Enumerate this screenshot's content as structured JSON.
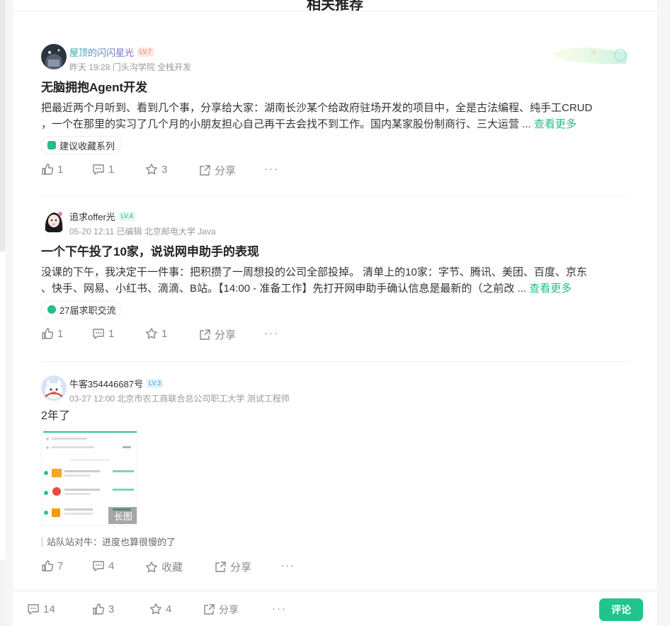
{
  "section_title": "相关推荐",
  "posts": [
    {
      "author": "屋顶的闪闪星光",
      "level": "LV.7",
      "meta": "昨天 19:28  门头沟学院 全栈开发",
      "title": "无脑拥抱Agent开发",
      "body_line1": "把最近两个月听到、看到几个事，分享给大家：湖南长沙某个给政府驻场开发的项目中，全是古法编程、纯手工CRUD",
      "body_line2": "，一个在那里的实习了几个月的小朋友担心自己再干去会找不到工作。国内某家股份制商行、三大运营 ...",
      "more": "查看更多",
      "tag": "建议收藏系列",
      "likes": "1",
      "comments": "1",
      "stars": "3",
      "share": "分享",
      "dots": "···"
    },
    {
      "author": "追求offer光",
      "level": "LV.4",
      "meta": "05-20 12:11  已编辑  北京邮电大学 Java",
      "title": "一个下午投了10家，说说网申助手的表现",
      "body_line1": "没课的下午，我决定干一件事：把积攒了一周想投的公司全部投掉。 清单上的10家：字节、腾讯、美团、百度、京东",
      "body_line2": "、快手、网易、小红书、滴滴、B站。【14:00 - 准备工作】先打开网申助手确认信息是最新的（之前改 ...",
      "more": "查看更多",
      "tag": "27届求职交流",
      "likes": "1",
      "comments": "1",
      "stars": "1",
      "share": "分享",
      "dots": "···"
    },
    {
      "author": "牛客354446687号",
      "level": "LV.3",
      "meta": "03-27 12:00  北京市农工商联合总公司职工大学 测试工程师",
      "body": "2年了",
      "image_badge": "长图",
      "quote": "站队站对牛：进度也算很慢的了",
      "likes": "7",
      "comments": "4",
      "stars": "收藏",
      "share": "分享",
      "dots": "···"
    }
  ],
  "footer": {
    "comments": "14",
    "likes": "3",
    "stars": "4",
    "share": "分享",
    "dots": "···",
    "comment_button": "评论"
  },
  "colors": {
    "accent": "#20c48c",
    "link": "#1fbf8a"
  }
}
